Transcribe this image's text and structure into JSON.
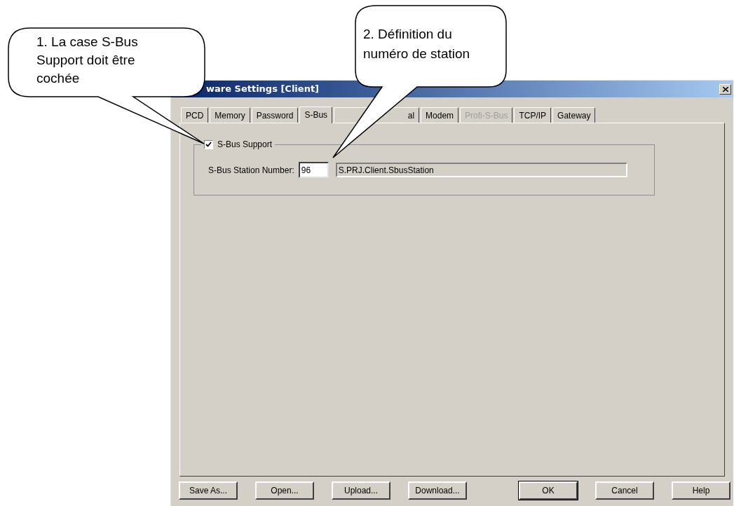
{
  "dialog": {
    "title": "ware Settings [Client]",
    "tabs": [
      {
        "label": "PCD",
        "selected": false,
        "disabled": false
      },
      {
        "label": "Memory",
        "selected": false,
        "disabled": false
      },
      {
        "label": "Password",
        "selected": false,
        "disabled": false
      },
      {
        "label": "S-Bus",
        "selected": true,
        "disabled": false
      },
      {
        "label": "al",
        "selected": false,
        "disabled": false,
        "kind": "partial"
      },
      {
        "label": "Modem",
        "selected": false,
        "disabled": false
      },
      {
        "label": "Profi-S-Bus",
        "selected": false,
        "disabled": true
      },
      {
        "label": "TCP/IP",
        "selected": false,
        "disabled": false
      },
      {
        "label": "Gateway",
        "selected": false,
        "disabled": false
      }
    ],
    "group": {
      "checkbox": {
        "label": "S-Bus Support",
        "checked": true
      },
      "station_label": "S-Bus Station Number:",
      "station_value": "96",
      "symbol_value": "S.PRJ.Client.SbusStation"
    },
    "buttons": [
      {
        "label": "Save As...",
        "default": false
      },
      {
        "label": "Open...",
        "default": false
      },
      {
        "label": "Upload...",
        "default": false
      },
      {
        "label": "Download...",
        "default": false
      },
      {
        "label": "OK",
        "default": true
      },
      {
        "label": "Cancel",
        "default": false
      },
      {
        "label": "Help",
        "default": false
      }
    ]
  },
  "callouts": [
    {
      "text": "1. La case S-Bus Support doit être cochée"
    },
    {
      "text": "2. Définition du numéro de station"
    }
  ]
}
